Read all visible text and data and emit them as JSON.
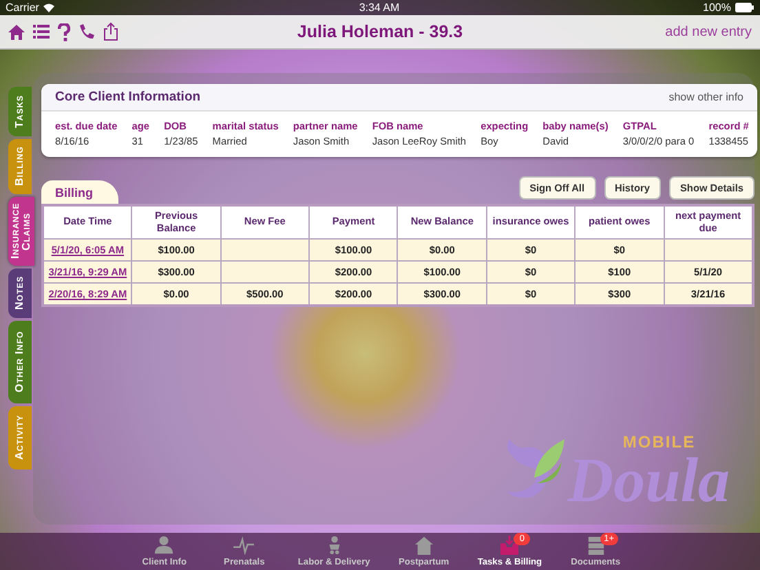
{
  "status_bar": {
    "carrier": "Carrier",
    "time": "3:34 AM",
    "battery": "100%"
  },
  "nav_bar": {
    "title": "Julia Holeman - 39.3",
    "action": "add new entry"
  },
  "side_tabs": [
    {
      "label": "Tasks",
      "color": "#4e7d1e",
      "selected": false
    },
    {
      "label": "Billing",
      "color": "#c8920e",
      "selected": false
    },
    {
      "label": "Insurance Claims",
      "color": "#c2358f",
      "selected": true
    },
    {
      "label": "Notes",
      "color": "#5a3d78",
      "selected": false
    },
    {
      "label": "Other Info",
      "color": "#4e7d1e",
      "selected": false
    },
    {
      "label": "Activity",
      "color": "#c8920e",
      "selected": false
    }
  ],
  "core_info": {
    "title": "Core Client Information",
    "link": "show other info",
    "fields": [
      {
        "label": "est. due date",
        "value": "8/16/16"
      },
      {
        "label": "age",
        "value": "31"
      },
      {
        "label": "DOB",
        "value": "1/23/85"
      },
      {
        "label": "marital status",
        "value": "Married"
      },
      {
        "label": "partner name",
        "value": "Jason Smith"
      },
      {
        "label": "FOB name",
        "value": "Jason LeeRoy Smith"
      },
      {
        "label": "expecting",
        "value": "Boy"
      },
      {
        "label": "baby name(s)",
        "value": "David"
      },
      {
        "label": "GTPAL",
        "value": "3/0/0/2/0 para 0"
      },
      {
        "label": "record #",
        "value": "1338455"
      }
    ]
  },
  "billing": {
    "title": "Billing",
    "buttons": [
      "Sign Off All",
      "History",
      "Show Details"
    ],
    "columns": [
      "Date Time",
      "Previous Balance",
      "New Fee",
      "Payment",
      "New Balance",
      "insurance owes",
      "patient owes",
      "next payment due"
    ],
    "rows": [
      [
        "5/1/20, 6:05 AM",
        "$100.00",
        "",
        "$100.00",
        "$0.00",
        "$0",
        "$0",
        ""
      ],
      [
        "3/21/16, 9:29 AM",
        "$300.00",
        "",
        "$200.00",
        "$100.00",
        "$0",
        "$100",
        "5/1/20"
      ],
      [
        "2/20/16, 8:29 AM",
        "$0.00",
        "$500.00",
        "$200.00",
        "$300.00",
        "$0",
        "$300",
        "3/21/16"
      ]
    ]
  },
  "logo": {
    "small": "MOBILE",
    "large": "Doula"
  },
  "tab_bar": [
    {
      "label": "Client Info",
      "selected": false
    },
    {
      "label": "Prenatals",
      "selected": false
    },
    {
      "label": "Labor & Delivery",
      "selected": false
    },
    {
      "label": "Postpartum",
      "selected": false
    },
    {
      "label": "Tasks & Billing",
      "selected": true,
      "badge": "0"
    },
    {
      "label": "Documents",
      "selected": false,
      "badge": "1+"
    }
  ]
}
